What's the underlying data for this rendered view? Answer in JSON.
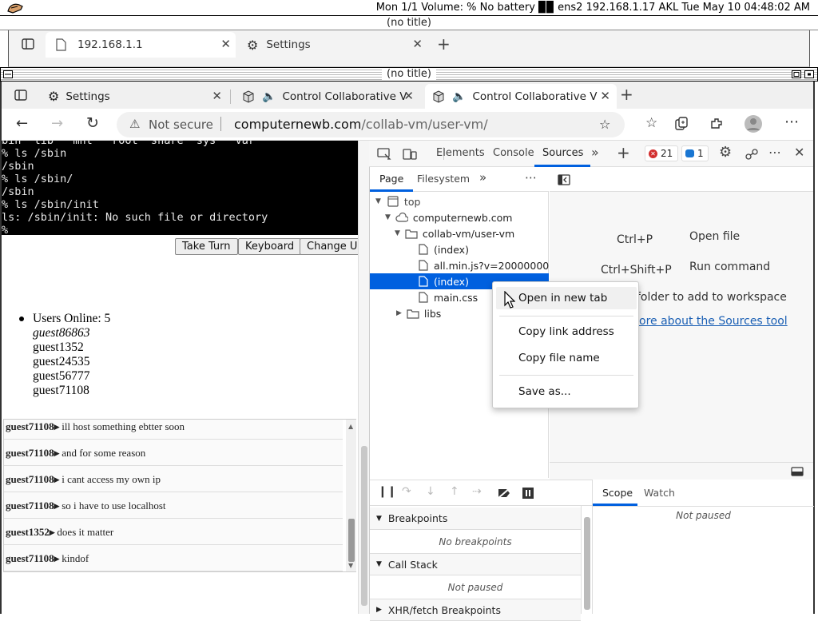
{
  "statusbar": {
    "text": "Mon 1/1 Volume: % No battery ▉▉ ens2 192.168.1.17 AKL Tue May 10 04:48:02 AM"
  },
  "window1": {
    "title": "(no title)",
    "tabs": [
      {
        "label": "192.168.1.1"
      },
      {
        "label": "Settings"
      }
    ]
  },
  "window2": {
    "title": "(no title)",
    "tabs": [
      {
        "label": "Settings"
      },
      {
        "label": "Control Collaborative V"
      },
      {
        "label": "Control Collaborative V"
      }
    ],
    "address": {
      "security": "Not secure",
      "host": "computernewb.com",
      "path": "/collab-vm/user-vm/"
    }
  },
  "terminal": {
    "lines": [
      "bin  lib   mnt   root  share  sys   var",
      "% ls /sbin",
      "/sbin",
      "% ls /sbin/",
      "/sbin",
      "% ls /sbin/init",
      "ls: /sbin/init: No such file or directory",
      "% _"
    ]
  },
  "vm_buttons": {
    "take_turn": "Take Turn",
    "keyboard": "Keyboard",
    "change_username": "Change Us"
  },
  "users": {
    "online": "Users Online: 5",
    "list": [
      "guest86863",
      "guest1352",
      "guest24535",
      "guest56777",
      "guest71108"
    ]
  },
  "chat": [
    {
      "user": "guest71108▸",
      "msg": "ill host something ebtter soon"
    },
    {
      "user": "guest71108▸",
      "msg": "and for some reason"
    },
    {
      "user": "guest71108▸",
      "msg": "i cant access my own ip"
    },
    {
      "user": "guest71108▸",
      "msg": "so i have to use localhost"
    },
    {
      "user": "guest1352▸",
      "msg": "does it matter"
    },
    {
      "user": "guest71108▸",
      "msg": "kindof"
    }
  ],
  "devtools": {
    "tabs": {
      "elements": "Elements",
      "console": "Console",
      "sources": "Sources"
    },
    "errors": "21",
    "infos": "1",
    "subtabs": {
      "page": "Page",
      "filesystem": "Filesystem"
    },
    "tree": {
      "top": "top",
      "domain": "computernewb.com",
      "folder": "collab-vm/user-vm",
      "index1": "(index)",
      "alljs": "all.min.js?v=20000000059",
      "index2": "(index)",
      "maincss": "main.css",
      "libs": "libs"
    },
    "shortcuts": [
      {
        "key": "Ctrl+P",
        "action": "Open file"
      },
      {
        "key": "Ctrl+Shift+P",
        "action": "Run command"
      }
    ],
    "drop_hint": "folder to add to workspace",
    "learn_more": "ore about the Sources tool",
    "context_menu": [
      "Open in new tab",
      "Copy link address",
      "Copy file name",
      "Save as..."
    ],
    "debugger": {
      "breakpoints": "Breakpoints",
      "no_breakpoints": "No breakpoints",
      "call_stack": "Call Stack",
      "not_paused": "Not paused",
      "xhr": "XHR/fetch Breakpoints",
      "scope": "Scope",
      "watch": "Watch",
      "scope_not_paused": "Not paused"
    }
  }
}
